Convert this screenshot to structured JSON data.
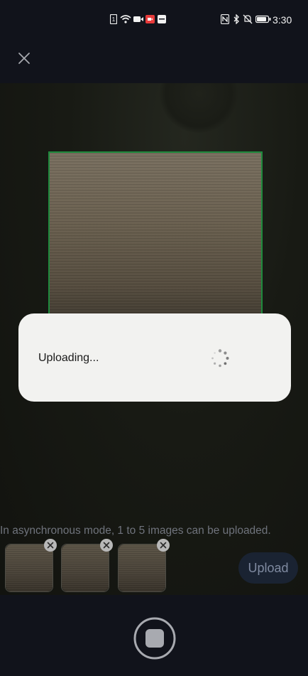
{
  "status_bar": {
    "time": "3:30",
    "icons": [
      "sim-icon",
      "wifi-icon",
      "video-icon",
      "camera-record-icon",
      "message-icon",
      "nfc-icon",
      "bluetooth-icon",
      "mute-icon",
      "battery-icon"
    ]
  },
  "header": {
    "close_icon": "close-icon"
  },
  "dialog": {
    "text": "Uploading..."
  },
  "hint": {
    "text": "In asynchronous mode, 1 to 5 images can be uploaded."
  },
  "thumbnails": {
    "count": 3
  },
  "actions": {
    "upload_label": "Upload"
  },
  "colors": {
    "background": "#11131b",
    "dialog_bg": "#f2f2f0",
    "crop_border": "#1e8a3c",
    "hint_text": "#6f737c",
    "upload_btn_bg": "#1a2332",
    "upload_btn_text": "#7f8aa0"
  }
}
